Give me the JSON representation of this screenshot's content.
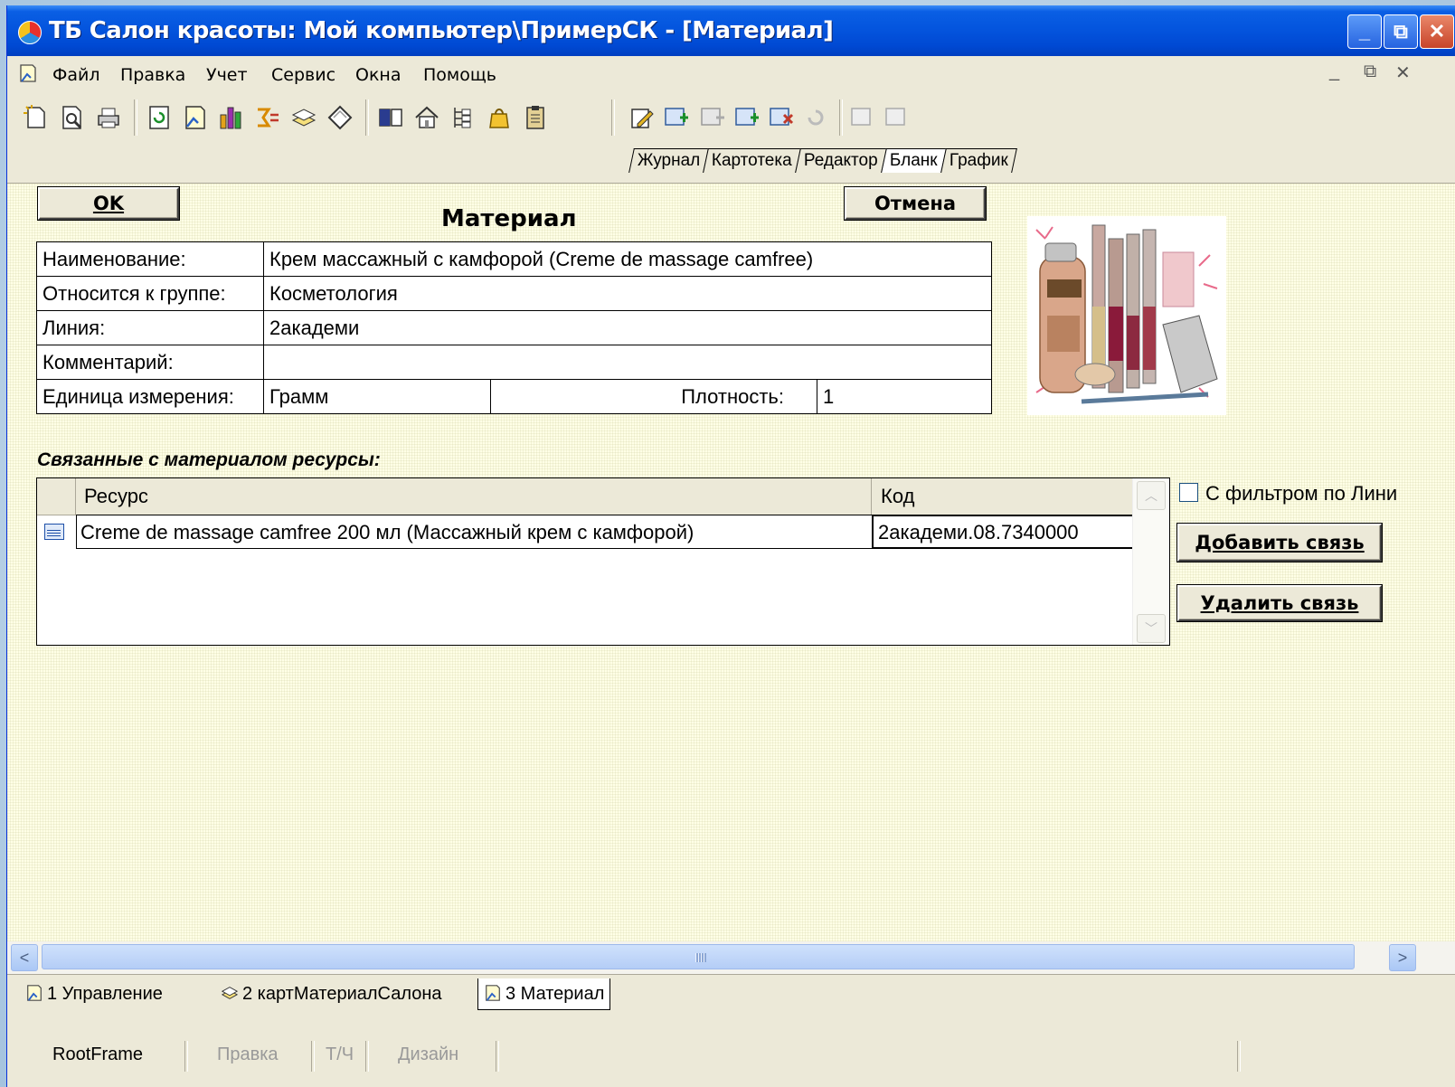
{
  "window": {
    "title": "ТБ Салон красоты: Мой компьютер\\ПримерСК - [Материал]",
    "controls": {
      "minimize": "_",
      "restore": "⧉",
      "close": "✕"
    }
  },
  "menu": {
    "items": [
      "Файл",
      "Правка",
      "Учет",
      "Сервис",
      "Окна",
      "Помощь"
    ],
    "mdi_minimize": "_",
    "mdi_restore": "⧉",
    "mdi_close": "✕"
  },
  "view_tabs": [
    "Журнал",
    "Картотека",
    "Редактор",
    "Бланк",
    "График"
  ],
  "active_view_tab": "Бланк",
  "form": {
    "ok_label": "OK",
    "cancel_label": "Отмена",
    "title": "Материал",
    "fields": {
      "name_label": "Наименование:",
      "name_value": "Крем массажный с камфорой (Creme de massage camfree)",
      "group_label": "Относится к группе:",
      "group_value": "Косметология",
      "line_label": "Линия:",
      "line_value": "2академи",
      "comment_label": "Комментарий:",
      "comment_value": "",
      "unit_label": "Единица измерения:",
      "unit_value": "Грамм",
      "density_label": "Плотность:",
      "density_value": "1"
    }
  },
  "resources": {
    "section_label": "Связанные с материалом ресурсы:",
    "columns": [
      "Ресурс",
      "Код"
    ],
    "rows": [
      {
        "resource": "Creme de massage camfree 200 мл (Массажный крем с камфорой)",
        "code": "2академи.08.7340000"
      }
    ],
    "filter_checkbox_label": "С фильтром по Лини",
    "filter_checked": false,
    "add_link_label": "Добавить связь",
    "remove_link_label": "Удалить связь"
  },
  "window_tabs": [
    "1 Управление",
    "2 картМатериалСалона",
    "3 Материал"
  ],
  "active_window_tab": "3 Материал",
  "status": {
    "items": [
      "RootFrame",
      "Правка",
      "Т/Ч",
      "Дизайн"
    ]
  },
  "colors": {
    "titlebar": "#0455de",
    "form_background": "#ffffe6",
    "chrome": "#ece9d8"
  },
  "icons": [
    "new-doc-icon",
    "preview-icon",
    "print-icon",
    "refresh-icon",
    "doc-icon",
    "chart-icon",
    "sum-icon",
    "stack-icon",
    "tag-icon",
    "book-icon",
    "home-icon",
    "tree-icon",
    "bag-icon",
    "clipboard-icon",
    "edit-icon",
    "record-add-icon",
    "record-copy-icon",
    "record-insert-icon",
    "record-delete-icon",
    "record-refresh-icon",
    "record-prev-icon",
    "record-next-icon"
  ]
}
